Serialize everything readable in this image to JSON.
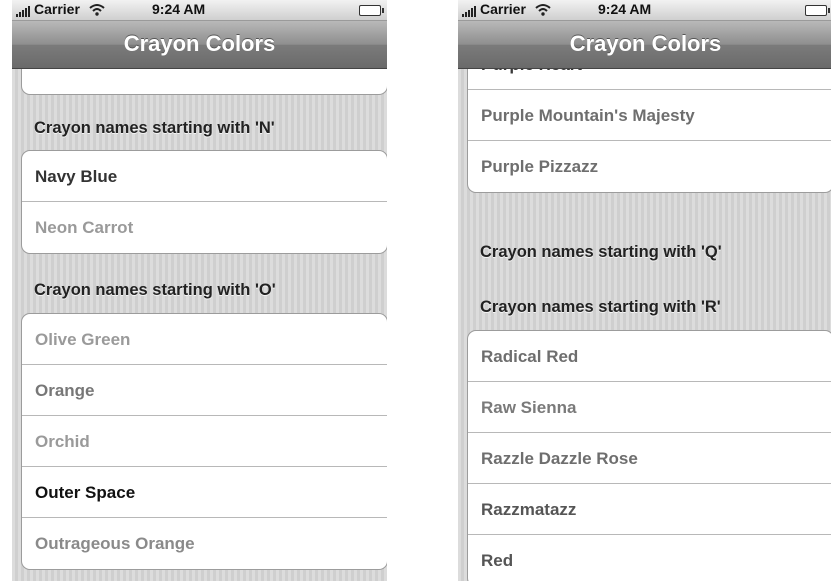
{
  "status_bar": {
    "carrier": "Carrier",
    "time": "9:24 AM"
  },
  "nav": {
    "title": "Crayon Colors"
  },
  "left": {
    "header_n": "Crayon names starting with 'N'",
    "header_o": "Crayon names starting with 'O'",
    "n_items": [
      {
        "label": "Navy Blue",
        "color": "#333333"
      },
      {
        "label": "Neon Carrot",
        "color": "#9a9a9a"
      }
    ],
    "o_items": [
      {
        "label": "Olive Green",
        "color": "#9a9a9a"
      },
      {
        "label": "Orange",
        "color": "#777777"
      },
      {
        "label": "Orchid",
        "color": "#9a9a9a"
      },
      {
        "label": "Outer Space",
        "color": "#111111"
      },
      {
        "label": "Outrageous Orange",
        "color": "#8a8a8a"
      }
    ]
  },
  "right": {
    "header_q": "Crayon names starting with 'Q'",
    "header_r": "Crayon names starting with 'R'",
    "p_items": [
      {
        "label": "Purple Heart",
        "color": "#3a3a3a"
      },
      {
        "label": "Purple Mountain's Majesty",
        "color": "#6e6e6e"
      },
      {
        "label": "Purple Pizzazz",
        "color": "#6e6e6e"
      }
    ],
    "r_items": [
      {
        "label": "Radical Red",
        "color": "#6e6e6e"
      },
      {
        "label": "Raw Sienna",
        "color": "#7a7a7a"
      },
      {
        "label": "Razzle Dazzle Rose",
        "color": "#6e6e6e"
      },
      {
        "label": "Razzmatazz",
        "color": "#555555"
      },
      {
        "label": "Red",
        "color": "#555555"
      }
    ]
  }
}
